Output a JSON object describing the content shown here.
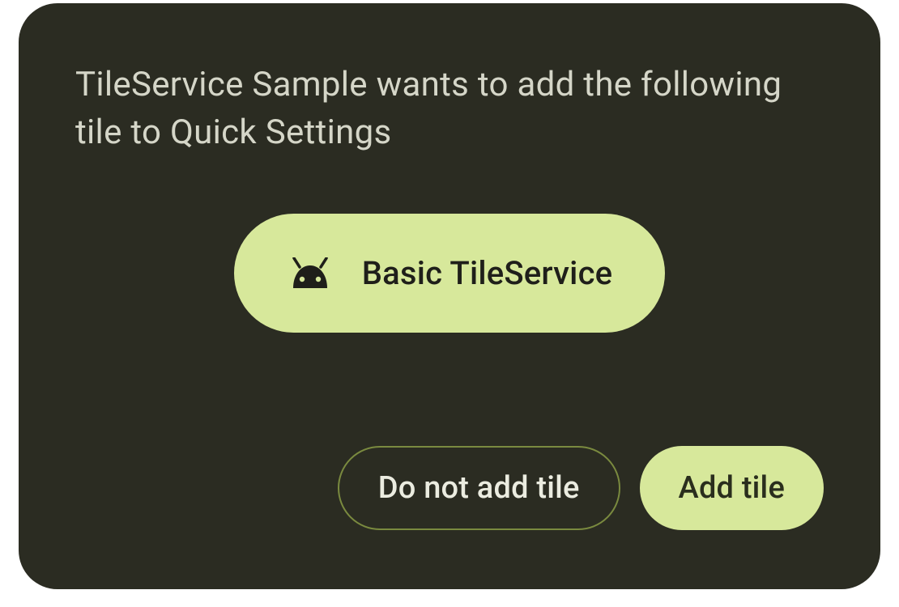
{
  "dialog": {
    "title": "TileService Sample wants to add the following tile to Quick Settings",
    "tile": {
      "icon": "android-icon",
      "label": "Basic TileService"
    },
    "buttons": {
      "decline": "Do not add tile",
      "accept": "Add tile"
    }
  },
  "colors": {
    "background": "#2b2c22",
    "accent": "#d7e89b",
    "text_light": "#d5d6c8",
    "text_dark": "#1f1f1a",
    "outline": "#7a8a3f"
  }
}
